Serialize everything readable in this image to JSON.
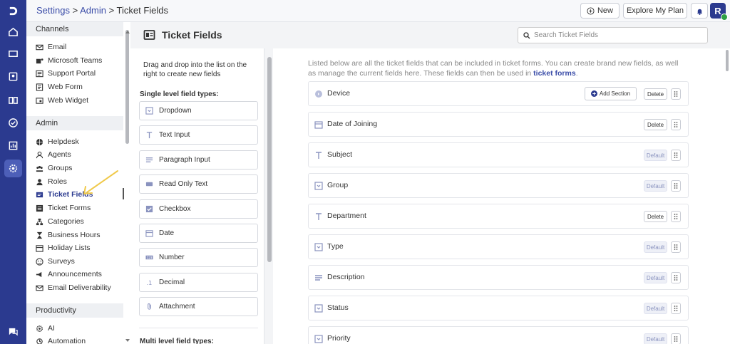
{
  "breadcrumb": {
    "settings": "Settings",
    "sep1": " > ",
    "admin": "Admin",
    "sep2": " > ",
    "current": "Ticket Fields"
  },
  "header": {
    "new_label": "New",
    "plan_label": "Explore My Plan",
    "avatar_letter": "R"
  },
  "rail": {
    "icons": [
      "logo-icon",
      "home-icon",
      "tickets-icon",
      "contacts-icon",
      "knowledge-base-icon",
      "tasks-icon",
      "reports-icon",
      "settings-icon",
      "chat-icon"
    ]
  },
  "sidebar": {
    "channels_title": "Channels",
    "channels": [
      "Email",
      "Microsoft Teams",
      "Support Portal",
      "Web Form",
      "Web Widget"
    ],
    "admin_title": "Admin",
    "admin": [
      "Helpdesk",
      "Agents",
      "Groups",
      "Roles",
      "Ticket Fields",
      "Ticket Forms",
      "Categories",
      "Business Hours",
      "Holiday Lists",
      "Surveys",
      "Announcements",
      "Email Deliverability"
    ],
    "productivity_title": "Productivity",
    "productivity": [
      "AI",
      "Automation"
    ],
    "active_item": "Ticket Fields"
  },
  "page": {
    "title": "Ticket Fields",
    "search_placeholder": "Search Ticket Fields"
  },
  "palette": {
    "intro": "Drag and drop into the list on the right to create new fields",
    "single_title": "Single level field types:",
    "single_items": [
      "Dropdown",
      "Text Input",
      "Paragraph Input",
      "Read Only Text",
      "Checkbox",
      "Date",
      "Number",
      "Decimal",
      "Attachment"
    ],
    "multi_title": "Multi level field types:"
  },
  "list": {
    "intro_text": "Listed below are all the ticket fields that can be included in ticket forms. You can create brand new fields, as well as manage the current fields here. These fields can then be used in ",
    "intro_link": "ticket forms",
    "intro_end": ".",
    "add_section_label": "Add Section",
    "delete_label": "Delete",
    "default_label": "Default",
    "fields": [
      {
        "name": "Device",
        "action": "Delete",
        "add_section": true
      },
      {
        "name": "Date of Joining",
        "action": "Delete"
      },
      {
        "name": "Subject",
        "action": "Default"
      },
      {
        "name": "Group",
        "action": "Default"
      },
      {
        "name": "Department",
        "action": "Delete"
      },
      {
        "name": "Type",
        "action": "Default"
      },
      {
        "name": "Description",
        "action": "Default"
      },
      {
        "name": "Status",
        "action": "Default"
      },
      {
        "name": "Priority",
        "action": "Default"
      }
    ]
  },
  "colors": {
    "rail": "#2b3a8f",
    "accent": "#3b4da8",
    "annotation_arrow": "#f0c94a"
  }
}
